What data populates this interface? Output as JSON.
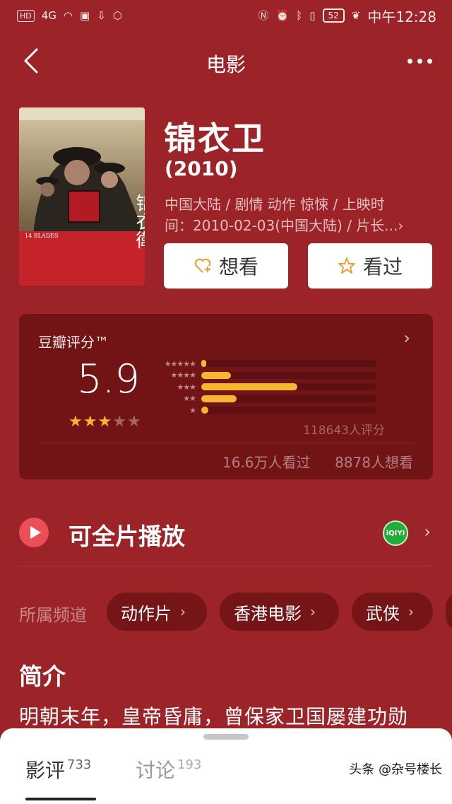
{
  "status_bar": {
    "network": "4G",
    "battery": "52",
    "time": "中午12:28"
  },
  "nav": {
    "title": "电影"
  },
  "movie": {
    "title": "锦衣卫",
    "year": "(2010)",
    "meta_line1": "中国大陆 / 剧情 动作 惊悚 / 上映时",
    "meta_line2": "间：2010-02-03(中国大陆) / 片长...›",
    "poster_text": "锦衣衛",
    "poster_caption": "14 BLADES"
  },
  "actions": {
    "want_label": "想看",
    "seen_label": "看过"
  },
  "rating": {
    "header": "豆瓣评分™",
    "score": "5.9",
    "stars_filled": 3,
    "stars_total": 5,
    "distribution": [
      {
        "stars": "★★★★★",
        "fraction": 0.03
      },
      {
        "stars": "★★★★",
        "fraction": 0.17
      },
      {
        "stars": "★★★",
        "fraction": 0.55
      },
      {
        "stars": "★★",
        "fraction": 0.2
      },
      {
        "stars": "★",
        "fraction": 0.04
      }
    ],
    "count": "118643人评分",
    "seen": "16.6万人看过",
    "wish": "8878人想看",
    "star_color": "#f7b631"
  },
  "play": {
    "label": "可全片播放",
    "provider": "iQIYI"
  },
  "channels": {
    "label": "所属频道",
    "items": [
      "动作片",
      "香港电影",
      "武侠"
    ]
  },
  "intro": {
    "title": "简介",
    "text": "明朝末年，皇帝昏庸，曾保家卫国屡建功勋"
  },
  "tabs": [
    {
      "label": "影评",
      "count": "733"
    },
    {
      "label": "讨论",
      "count": "193"
    }
  ],
  "watermark": "头条 @杂号楼长",
  "colors": {
    "background": "#9c2327",
    "accent": "#f7b631",
    "play": "#ea4f58",
    "iqiyi": "#22ad38"
  }
}
